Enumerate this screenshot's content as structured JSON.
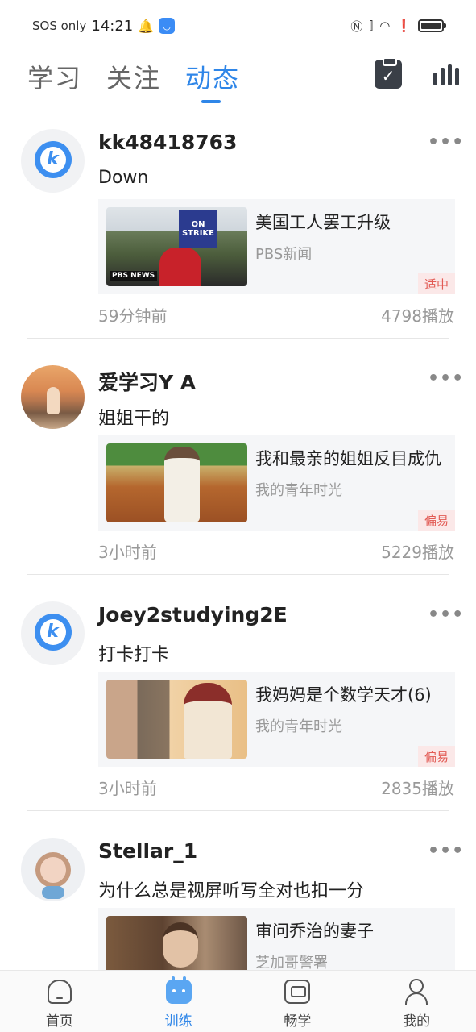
{
  "status_bar": {
    "carrier": "SOS only",
    "time": "14:21",
    "battery_level": 0.85,
    "icons": [
      "bell-icon",
      "app-notification-icon",
      "nfc-icon",
      "vibrate-icon",
      "wifi-icon",
      "alert-icon",
      "battery-icon"
    ]
  },
  "top_nav": {
    "tabs": [
      {
        "label": "学习",
        "active": false
      },
      {
        "label": "关注",
        "active": false
      },
      {
        "label": "动态",
        "active": true
      }
    ],
    "accent_color": "#2f86e8"
  },
  "posts": [
    {
      "username": "kk48418763",
      "avatar": "app-logo-pin",
      "text": "Down",
      "card": {
        "title": "美国工人罢工升级",
        "source": "PBS新闻",
        "level": "适中",
        "thumb_sign": "ON STRIKE",
        "thumb_logo": "PBS NEWS"
      },
      "time": "59分钟前",
      "plays": "4798播放"
    },
    {
      "username": "爱学习Y A",
      "avatar": "beach-photo",
      "text": "姐姐干的",
      "card": {
        "title": "我和最亲的姐姐反目成仇",
        "source": "我的青年时光",
        "level": "偏易"
      },
      "time": "3小时前",
      "plays": "5229播放"
    },
    {
      "username": "Joey2studying2E",
      "avatar": "app-logo-pin",
      "text": "打卡打卡",
      "card": {
        "title": "我妈妈是个数学天才(6)",
        "source": "我的青年时光",
        "level": "偏易"
      },
      "time": "3小时前",
      "plays": "2835播放"
    },
    {
      "username": "Stellar_1",
      "avatar": "doll-illustration",
      "text": "为什么总是视屏听写全对也扣一分",
      "card": {
        "title": "审问乔治的妻子",
        "source": "芝加哥警署",
        "level": ""
      },
      "time": "",
      "plays": ""
    }
  ],
  "bottom_nav": [
    {
      "label": "首页",
      "icon": "home-icon",
      "active": false
    },
    {
      "label": "训练",
      "icon": "training-icon",
      "active": true
    },
    {
      "label": "畅学",
      "icon": "tv-icon",
      "active": false
    },
    {
      "label": "我的",
      "icon": "profile-icon",
      "active": false
    }
  ],
  "level_badge_colors": {
    "background": "#fbe8e8",
    "text": "#e25b55"
  }
}
